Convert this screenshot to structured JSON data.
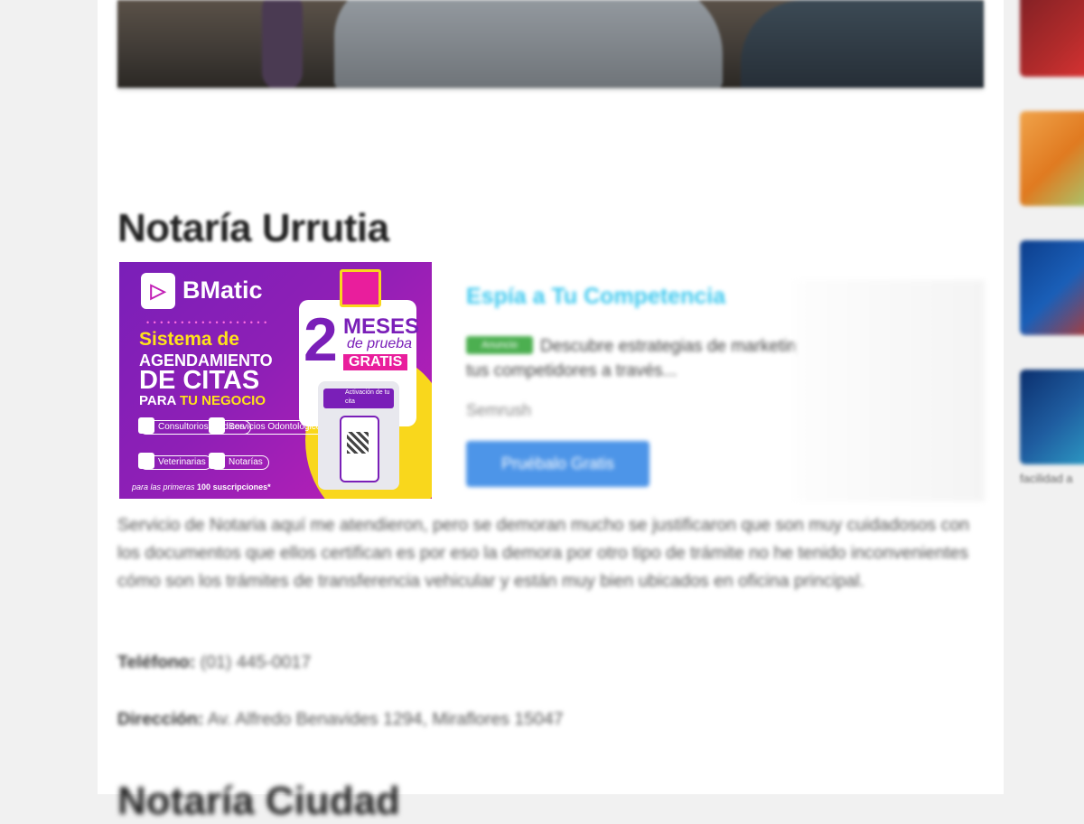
{
  "article": {
    "title": "Notaría Urrutia",
    "review": "Servicio de Notaria aquí me atendieron, pero se demoran mucho se justificaron que son muy cuidadosos con los documentos que ellos certifican es por eso la demora por otro tipo de trámite no he tenido inconvenientes cómo son los trámites de transferencia vehicular y están muy bien ubicados en oficina principal.",
    "phone_label": "Teléfono:",
    "phone_value": "(01) 445-0017",
    "address_label": "Dirección:",
    "address_value": "Av. Alfredo Benavides 1294, Miraflores 15047",
    "next_title": "Notaría Ciudad"
  },
  "banner_ad": {
    "brand": "BMatic",
    "line1": "Sistema de",
    "line2": "AGENDAMIENTO",
    "line3": "DE CITAS",
    "line4_prefix": "PARA",
    "line4_highlight": "TU NEGOCIO",
    "services": [
      "Consultorios Médicos",
      "Servicios Odontológicos",
      "Veterinarias",
      "Notarías"
    ],
    "footnote_prefix": "para las primeras",
    "footnote_bold": "100 suscripciones*",
    "months_number": "2",
    "months_label": "MESES",
    "trial_label": "de prueba",
    "free_label": "GRATIS",
    "kiosk_label": "Activación de tu cita"
  },
  "text_ad": {
    "title": "Espía a Tu Competencia",
    "badge": "Anuncio",
    "description": "Descubre estrategias de marketing de tus competidores a través...",
    "source": "Semrush",
    "cta": "Pruébalo Gratis"
  },
  "sidebar": {
    "caption": "facilidad a"
  }
}
